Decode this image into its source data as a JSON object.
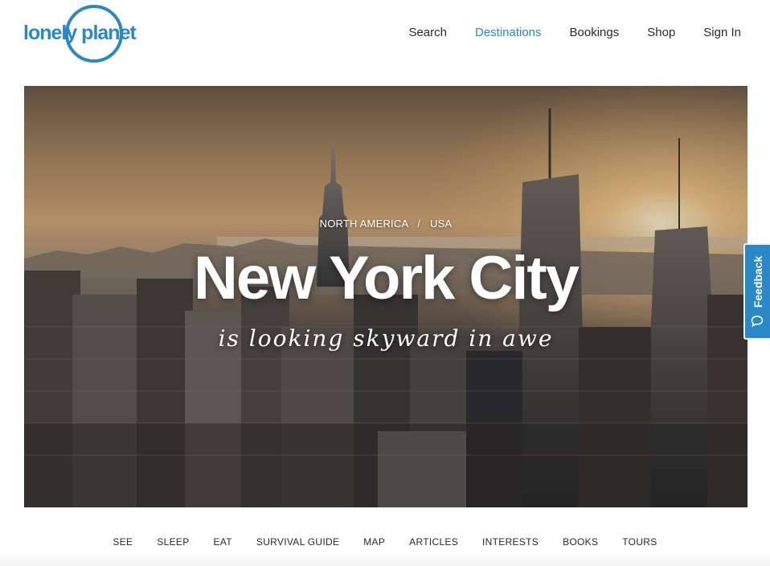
{
  "brand": {
    "logo_text": "lonely planet",
    "color": "#2a87c8"
  },
  "nav": {
    "items": [
      {
        "label": "Search",
        "active": false
      },
      {
        "label": "Destinations",
        "active": true
      },
      {
        "label": "Bookings",
        "active": false
      },
      {
        "label": "Shop",
        "active": false
      },
      {
        "label": "Sign In",
        "active": false
      }
    ]
  },
  "hero": {
    "breadcrumb": [
      "NORTH AMERICA",
      "USA"
    ],
    "breadcrumb_separator": "/",
    "title": "New York City",
    "tagline": "is looking skyward in awe"
  },
  "feedback": {
    "label": "Feedback",
    "icon": "speech-bubble-icon"
  },
  "subnav": {
    "items": [
      "SEE",
      "SLEEP",
      "EAT",
      "SURVIVAL GUIDE",
      "MAP",
      "ARTICLES",
      "INTERESTS",
      "BOOKS",
      "TOURS"
    ]
  }
}
